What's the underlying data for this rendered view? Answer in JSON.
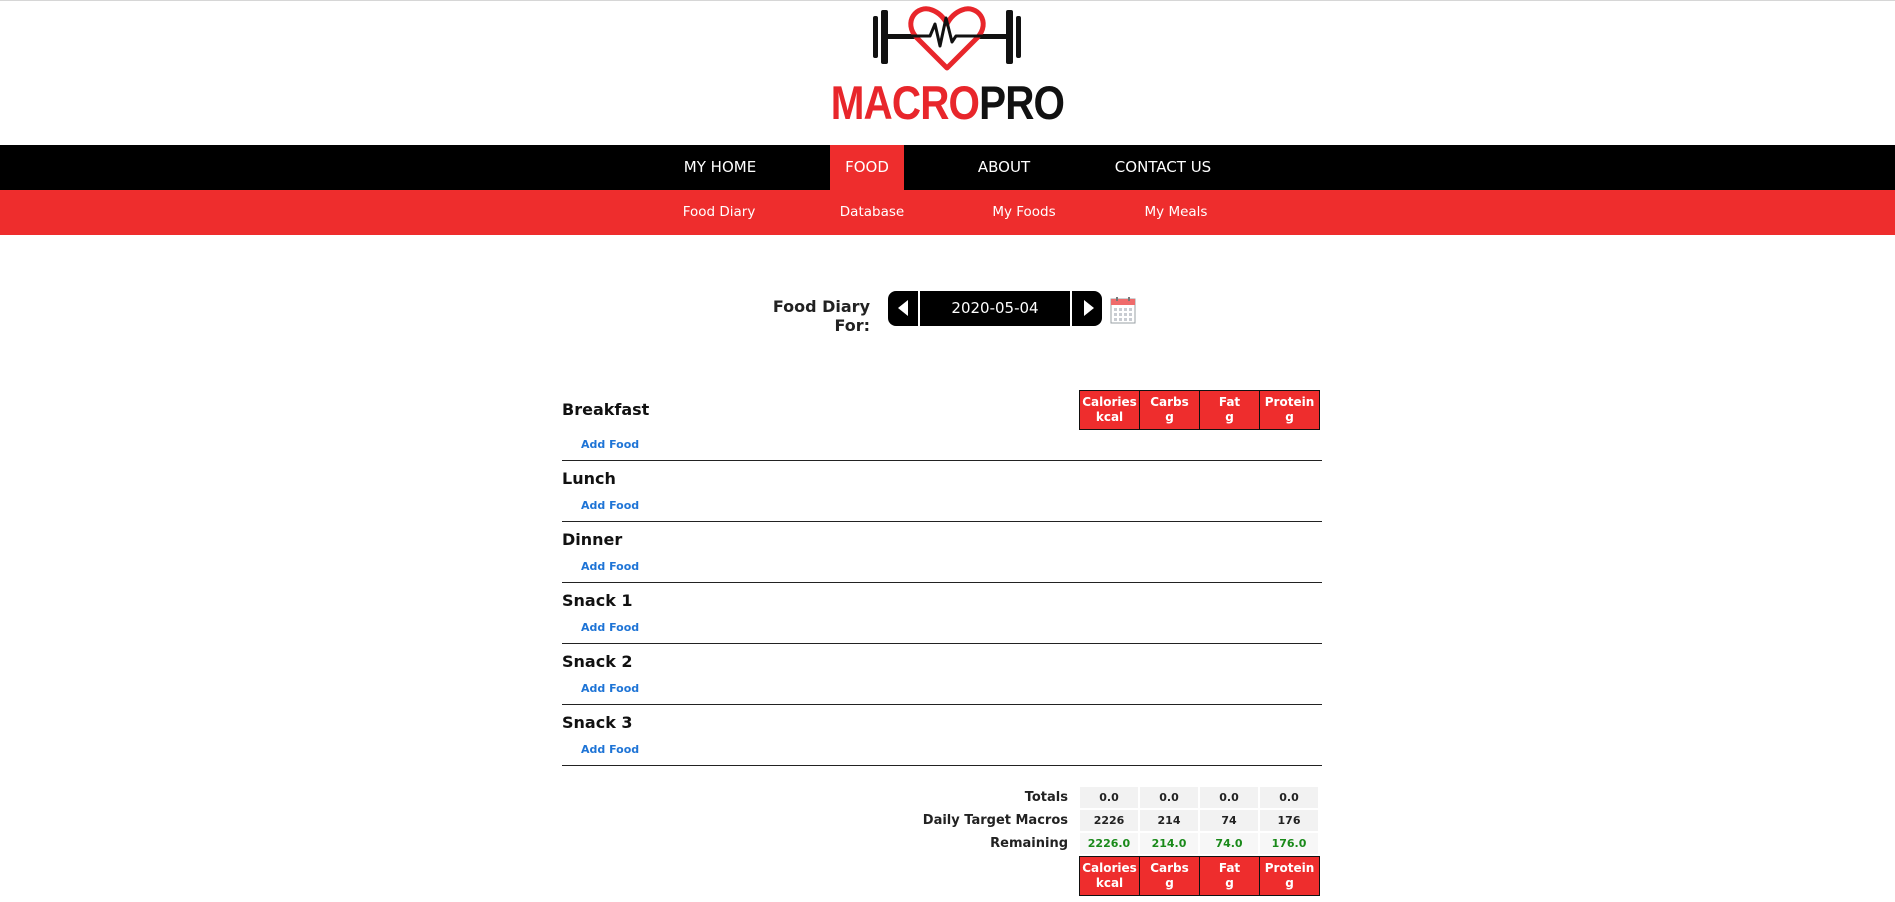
{
  "brand": {
    "part1": "MACRO",
    "part2": "PRO"
  },
  "nav": {
    "home": "MY HOME",
    "food": "FOOD",
    "about": "ABOUT",
    "contact": "CONTACT US"
  },
  "subnav": {
    "diary": "Food Diary",
    "database": "Database",
    "myfoods": "My Foods",
    "mymeals": "My Meals"
  },
  "diary": {
    "label": "Food Diary For:",
    "date": "2020-05-04"
  },
  "add_food_label": "Add Food",
  "meals": [
    "Breakfast",
    "Lunch",
    "Dinner",
    "Snack 1",
    "Snack 2",
    "Snack 3"
  ],
  "macro_headers": [
    {
      "name": "Calories",
      "unit": "kcal"
    },
    {
      "name": "Carbs",
      "unit": "g"
    },
    {
      "name": "Fat",
      "unit": "g"
    },
    {
      "name": "Protein",
      "unit": "g"
    }
  ],
  "summary": {
    "totals": {
      "label": "Totals",
      "values": [
        "0.0",
        "0.0",
        "0.0",
        "0.0"
      ]
    },
    "target": {
      "label": "Daily Target Macros",
      "values": [
        "2226",
        "214",
        "74",
        "176"
      ]
    },
    "remaining": {
      "label": "Remaining",
      "values": [
        "2226.0",
        "214.0",
        "74.0",
        "176.0"
      ]
    }
  },
  "colors": {
    "accent": "#ee2d2d",
    "nav_bg": "#000000",
    "link": "#1e74d6",
    "positive": "#1a8a1a"
  }
}
